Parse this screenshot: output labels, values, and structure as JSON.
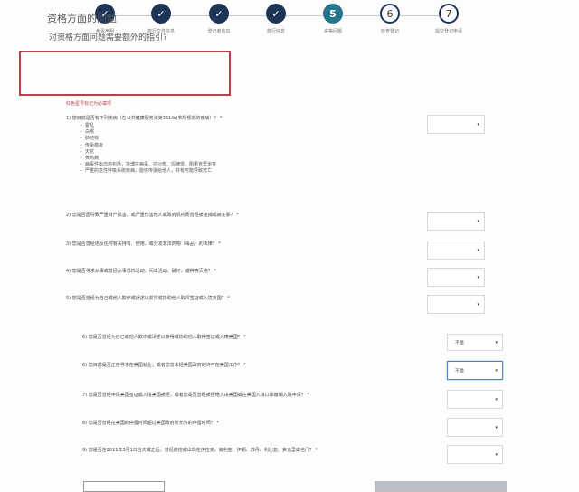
{
  "stepper": {
    "steps": [
      {
        "num": "1",
        "label": "免责声明",
        "state": "done"
      },
      {
        "num": "2",
        "label": "旅行文件信息",
        "state": "done"
      },
      {
        "num": "3",
        "label": "登记者信息",
        "state": "done"
      },
      {
        "num": "4",
        "label": "旅行信息",
        "state": "done"
      },
      {
        "num": "5",
        "label": "资格问题",
        "state": "current"
      },
      {
        "num": "6",
        "label": "检查登记",
        "state": "todo"
      },
      {
        "num": "7",
        "label": "提交登记申请",
        "state": "todo"
      }
    ],
    "check_glyph": "✓"
  },
  "section": {
    "title": "资格方面的问题",
    "help_link": "对资格方面问题需要额外的指引?",
    "required_note": "红色星号标记为必填项"
  },
  "questions": {
    "q1": "1) 您目前是否有下列疾病（在公共健康服务法第361(b)节所规定的疾病）？ *",
    "q1_items": [
      "霍乱",
      "白喉",
      "肺结核",
      "传染瘟疫",
      "天花",
      "黄热病",
      "病毒性出血热包括，埃博拉病毒、拉沙热、玛律堡、刚果克里米亚",
      "严重的急性呼吸系统疾病，能够传染给他人，并有可能导致死亡"
    ],
    "q2": "2) 您是否因导致严重财产损害、或严重伤害他人或政府机构而曾经被逮捕或被定罪？ *",
    "q3": "3) 您是否曾经违反任何有关持有、使用、或分发非法药物（毒品）的法律？ *",
    "q4": "4) 您是否寻求从事或曾经从事恐怖活动、间谍活动、破坏，或种族灭绝？ *",
    "q5": "5) 您是否曾经为自己或他人欺诈或误述以获得或协助他人取得签证或入境美国？ *",
    "q6": "6) 您是否曾经为自己或他人欺诈或误述以获得或协助他人取得签证或入境美国？ *",
    "q7": "6) 您目前是否正在寻求在美国就业；或者您曾未经美国政府的许可在美国工作？ *",
    "q8": "7) 您是否曾经申请美国签证或入境美国被拒，或者您是否曾经被拒绝入境美国或在美国入境口岸撤销入境申请？ *",
    "q9": "8) 您是否曾经在美国的停留时间超过美国政府所允许的停留时间？ *",
    "q10": "9) 您是否在2011年3月1日当天或之后，曾经前往或出现在伊拉克、叙利亚、伊朗、苏丹、利比亚、索马里或也门？ *"
  },
  "answers": {
    "a5": "不是",
    "a6": "不是"
  },
  "icons": {
    "dropdown": "chevron-down-icon",
    "chevron_glyph": "▾"
  },
  "colors": {
    "done": "#1c3557",
    "current": "#27748d",
    "highlight_box": "#b3434a"
  }
}
